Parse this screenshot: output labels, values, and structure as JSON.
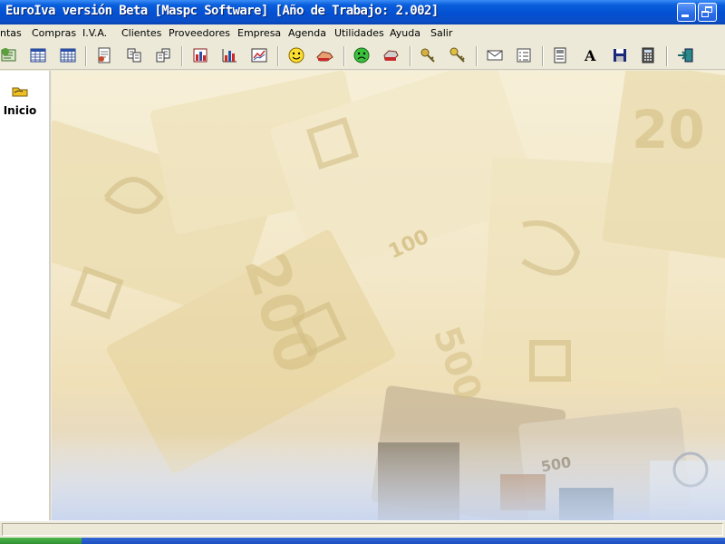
{
  "window": {
    "title": "EuroIva versión Beta [Maspc Software] [Año de Trabajo: 2.002]"
  },
  "menu": [
    "ntas",
    "Compras",
    "I.V.A.",
    "Clientes",
    "Proveedores",
    "Empresa",
    "Agenda",
    "Utilidades",
    "Ayuda",
    "Salir"
  ],
  "toolbar": {
    "icons": [
      "globe-icon",
      "table-icon",
      "grid-icon",
      "document-icon",
      "transfer-icon",
      "transfer-alt-icon",
      "report-icon",
      "bar-chart-icon",
      "line-chart-icon",
      "smiley-happy-icon",
      "hand-icon",
      "smiley-sad-icon",
      "printer-icon",
      "keys-icon",
      "key-icon",
      "envelope-icon",
      "checklist-icon",
      "form-icon",
      "font-icon",
      "save-icon",
      "calculator-icon",
      "exit-icon"
    ]
  },
  "sidebar": {
    "items": [
      {
        "label": "Inicio",
        "icon": "folder-hand-icon"
      }
    ]
  },
  "background": {
    "banknote_200": "200",
    "banknote_100": "100",
    "banknote_20": "20",
    "banknote_500": "500",
    "banknote_500b": "500"
  },
  "colors": {
    "title_bar": "#0450d2",
    "chrome": "#ECE9D8",
    "wallpaper": "#f3e8c9"
  }
}
